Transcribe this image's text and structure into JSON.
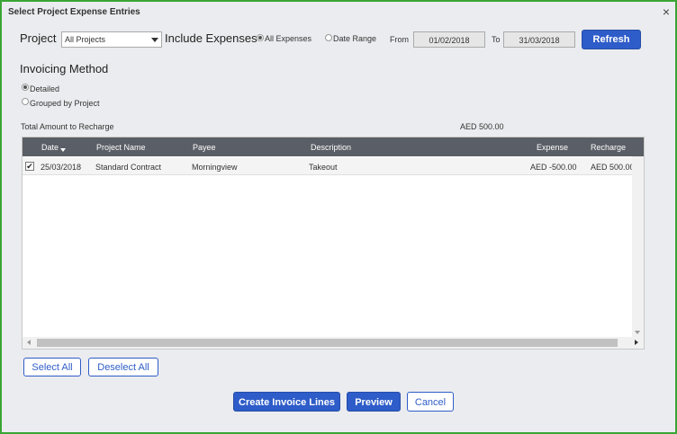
{
  "dialog": {
    "title": "Select Project Expense Entries",
    "close_glyph": "×"
  },
  "filters": {
    "project_label": "Project",
    "project_value": "All Projects",
    "include_label": "Include Expenses",
    "opt_all": "All Expenses",
    "opt_range": "Date Range",
    "selected": "All Expenses",
    "from_label": "From",
    "from_value": "01/02/2018",
    "to_label": "To",
    "to_value": "31/03/2018",
    "refresh_label": "Refresh"
  },
  "invoicing": {
    "heading": "Invoicing Method",
    "opt_detailed": "Detailed",
    "opt_grouped": "Grouped by Project",
    "selected": "Detailed"
  },
  "summary": {
    "total_label": "Total Amount to Recharge",
    "total_value": "AED 500.00"
  },
  "grid": {
    "columns": {
      "date": "Date",
      "project": "Project Name",
      "payee": "Payee",
      "description": "Description",
      "expense": "Expense",
      "recharge": "Recharge"
    },
    "rows": [
      {
        "checked": true,
        "date": "25/03/2018",
        "project": "Standard Contract",
        "payee": "Morningview",
        "description": "Takeout",
        "expense": "AED -500.00",
        "recharge": "AED 500.00"
      }
    ]
  },
  "actions": {
    "select_all": "Select All",
    "deselect_all": "Deselect All",
    "create": "Create Invoice Lines",
    "preview": "Preview",
    "cancel": "Cancel"
  },
  "colors": {
    "border": "#3aa535",
    "primary": "#2e5cc9",
    "header": "#5a5e66"
  }
}
